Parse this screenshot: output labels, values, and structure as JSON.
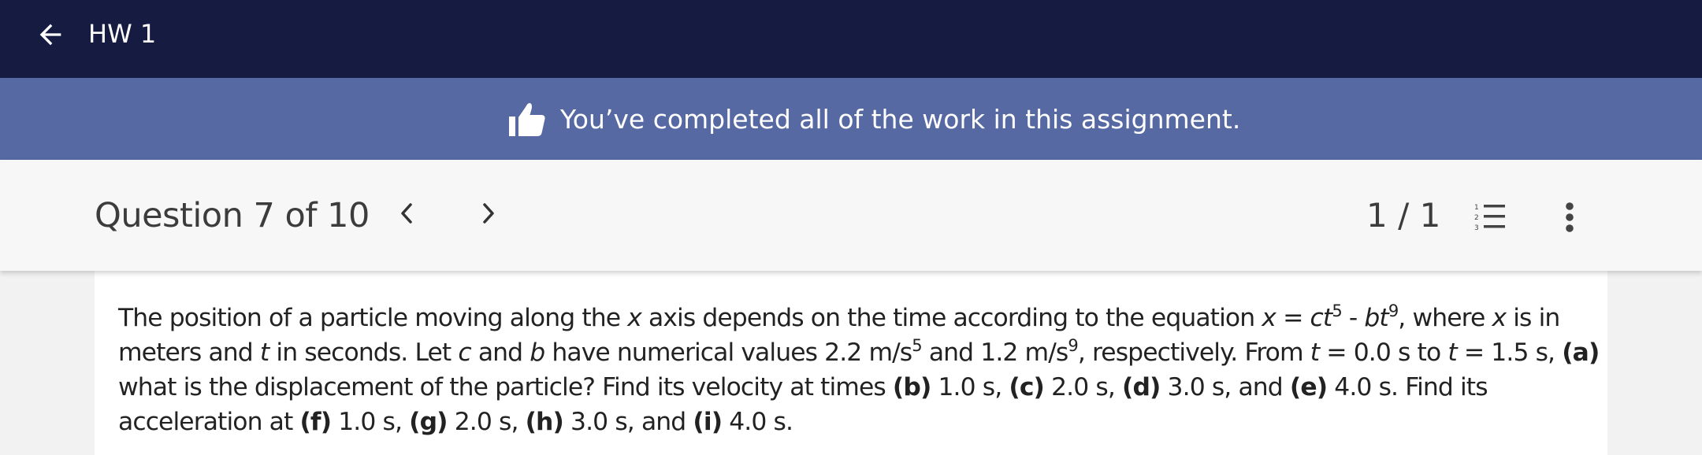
{
  "header": {
    "title": "HW 1",
    "back_icon": "arrow-left-icon",
    "background": "#151b41"
  },
  "banner": {
    "text": "You’ve completed all of the work in this assignment.",
    "icon": "thumbs-up-icon",
    "background": "#5769a3"
  },
  "question_nav": {
    "label": "Question 7 of 10",
    "prev_icon": "chevron-left-icon",
    "next_icon": "chevron-right-icon",
    "score": "1 / 1",
    "list_icon": "numbered-list-icon",
    "more_icon": "more-vertical-icon"
  },
  "question": {
    "segments": [
      {
        "text": "The position of a particle moving along the ",
        "style": ""
      },
      {
        "text": "x",
        "style": "i"
      },
      {
        "text": " axis depends on the time according to the equation ",
        "style": ""
      },
      {
        "text": "x",
        "style": "i"
      },
      {
        "text": " = ",
        "style": ""
      },
      {
        "text": "ct",
        "style": "i"
      },
      {
        "text": "5",
        "style": "sup"
      },
      {
        "text": " - ",
        "style": ""
      },
      {
        "text": "bt",
        "style": "i"
      },
      {
        "text": "9",
        "style": "sup"
      },
      {
        "text": ", where ",
        "style": ""
      },
      {
        "text": "x",
        "style": "i"
      },
      {
        "text": " is in meters and ",
        "style": ""
      },
      {
        "text": "t",
        "style": "i"
      },
      {
        "text": " in seconds. Let ",
        "style": ""
      },
      {
        "text": "c",
        "style": "i"
      },
      {
        "text": " and ",
        "style": ""
      },
      {
        "text": "b",
        "style": "i"
      },
      {
        "text": " have numerical values 2.2 m/s",
        "style": ""
      },
      {
        "text": "5",
        "style": "sup"
      },
      {
        "text": " and 1.2 m/s",
        "style": ""
      },
      {
        "text": "9",
        "style": "sup"
      },
      {
        "text": ", respectively. From ",
        "style": ""
      },
      {
        "text": "t",
        "style": "i"
      },
      {
        "text": " = 0.0 s to ",
        "style": ""
      },
      {
        "text": "t",
        "style": "i"
      },
      {
        "text": " = 1.5 s, ",
        "style": ""
      },
      {
        "text": "(a)",
        "style": "b"
      },
      {
        "text": " what is the displacement of the particle? Find its velocity at times ",
        "style": ""
      },
      {
        "text": "(b)",
        "style": "b"
      },
      {
        "text": " 1.0 s, ",
        "style": ""
      },
      {
        "text": "(c)",
        "style": "b"
      },
      {
        "text": " 2.0 s, ",
        "style": ""
      },
      {
        "text": "(d)",
        "style": "b"
      },
      {
        "text": " 3.0 s, and ",
        "style": ""
      },
      {
        "text": "(e)",
        "style": "b"
      },
      {
        "text": " 4.0 s. Find its acceleration at ",
        "style": ""
      },
      {
        "text": "(f)",
        "style": "b"
      },
      {
        "text": " 1.0 s, ",
        "style": ""
      },
      {
        "text": "(g)",
        "style": "b"
      },
      {
        "text": " 2.0 s, ",
        "style": ""
      },
      {
        "text": "(h)",
        "style": "b"
      },
      {
        "text": " 3.0 s, and ",
        "style": ""
      },
      {
        "text": "(i)",
        "style": "b"
      },
      {
        "text": " 4.0 s.",
        "style": ""
      }
    ]
  }
}
